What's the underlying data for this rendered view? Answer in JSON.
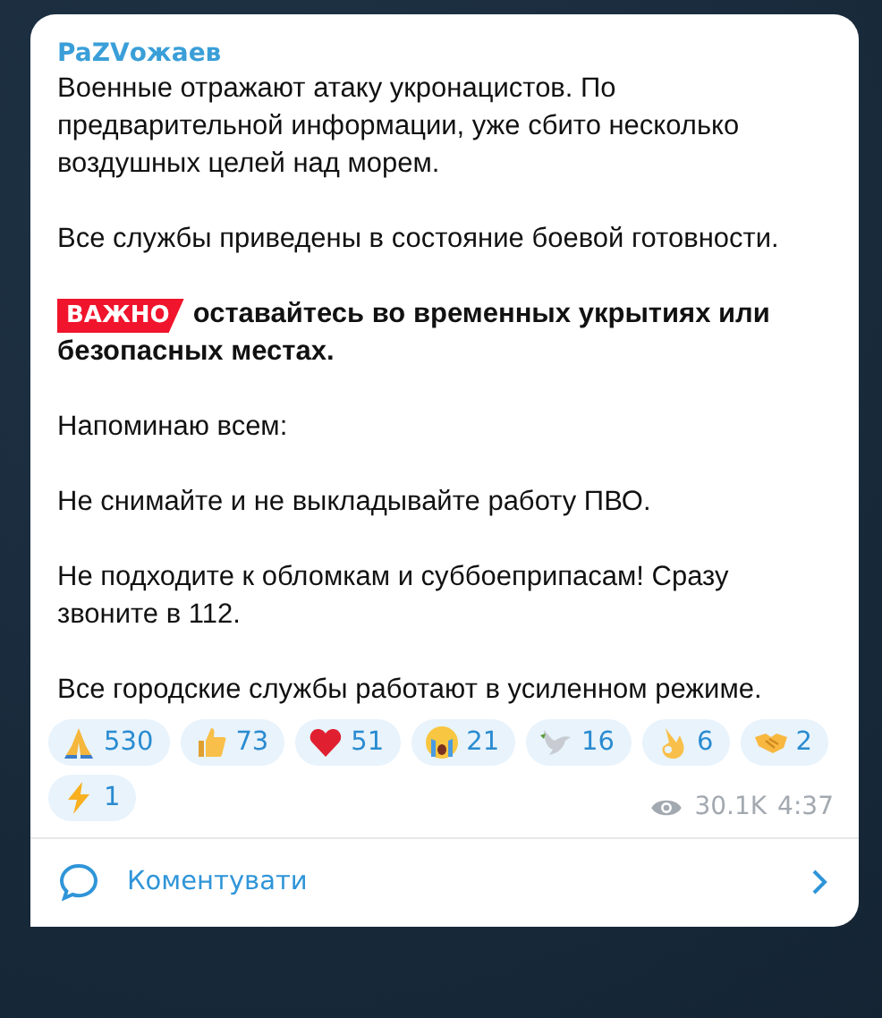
{
  "post": {
    "author": "PaZVожаев",
    "paragraphs": [
      {
        "kind": "plain",
        "text": "Военные отражают атаку укронацистов. По предварительной информации, уже сбито несколько воздушных целей над морем."
      },
      {
        "kind": "plain",
        "text": "Все службы приведены в состояние боевой готовности."
      },
      {
        "kind": "alert",
        "badge": "ВАЖНО",
        "text": "оставайтесь во временных укрытиях или безопасных местах."
      },
      {
        "kind": "plain",
        "text": "Напоминаю всем:"
      },
      {
        "kind": "plain",
        "text": "Не снимайте и не выкладывайте работу ПВО."
      },
      {
        "kind": "plain",
        "text": "Не подходите к обломкам и суббоеприпасам! Сразу звоните в 112."
      },
      {
        "kind": "plain",
        "text": "Все городские службы работают в усиленном режиме."
      }
    ],
    "reactions": [
      {
        "count": "530"
      },
      {
        "count": "73"
      },
      {
        "count": "51"
      },
      {
        "count": "21"
      },
      {
        "count": "16"
      },
      {
        "count": "6"
      },
      {
        "count": "2"
      },
      {
        "count": "1"
      }
    ],
    "views": "30.1K",
    "time": "4:37",
    "comment_button": "Коментувати"
  }
}
